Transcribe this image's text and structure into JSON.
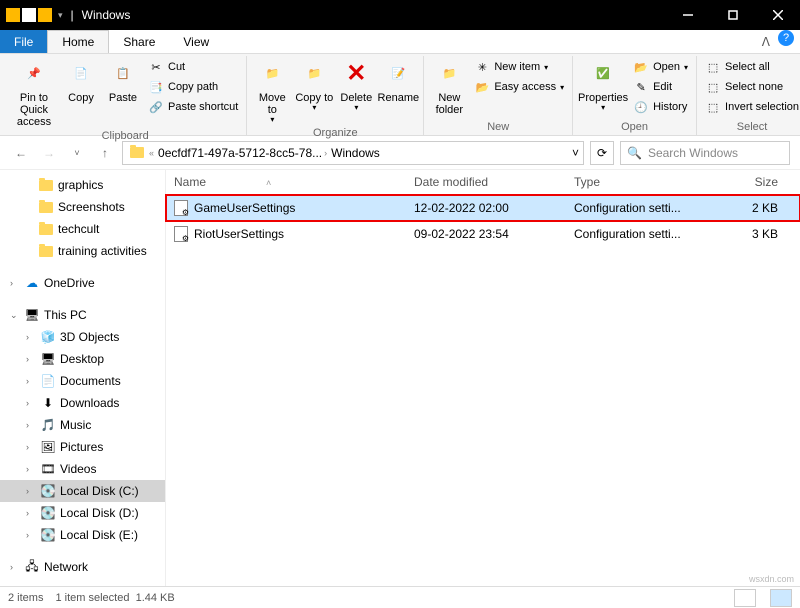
{
  "titlebar": {
    "title": "Windows"
  },
  "tabs": {
    "file": "File",
    "home": "Home",
    "share": "Share",
    "view": "View"
  },
  "ribbon": {
    "clipboard": {
      "label": "Clipboard",
      "pin": "Pin to Quick access",
      "copy": "Copy",
      "paste": "Paste",
      "cut": "Cut",
      "copypath": "Copy path",
      "shortcut": "Paste shortcut"
    },
    "organize": {
      "label": "Organize",
      "moveto": "Move to",
      "copyto": "Copy to",
      "delete": "Delete",
      "rename": "Rename"
    },
    "new": {
      "label": "New",
      "newfolder": "New folder",
      "newitem": "New item",
      "easyaccess": "Easy access"
    },
    "open": {
      "label": "Open",
      "properties": "Properties",
      "open": "Open",
      "edit": "Edit",
      "history": "History"
    },
    "select": {
      "label": "Select",
      "all": "Select all",
      "none": "Select none",
      "invert": "Invert selection"
    }
  },
  "breadcrumb": {
    "part1": "0ecfdf71-497a-5712-8cc5-78...",
    "part2": "Windows"
  },
  "search": {
    "placeholder": "Search Windows"
  },
  "tree": {
    "graphics": "graphics",
    "screenshots": "Screenshots",
    "techcult": "techcult",
    "training": "training activities",
    "onedrive": "OneDrive",
    "thispc": "This PC",
    "objects3d": "3D Objects",
    "desktop": "Desktop",
    "documents": "Documents",
    "downloads": "Downloads",
    "music": "Music",
    "pictures": "Pictures",
    "videos": "Videos",
    "diskc": "Local Disk (C:)",
    "diskd": "Local Disk (D:)",
    "diske": "Local Disk (E:)",
    "network": "Network"
  },
  "columns": {
    "name": "Name",
    "date": "Date modified",
    "type": "Type",
    "size": "Size"
  },
  "files": [
    {
      "name": "GameUserSettings",
      "date": "12-02-2022 02:00",
      "type": "Configuration setti...",
      "size": "2 KB"
    },
    {
      "name": "RiotUserSettings",
      "date": "09-02-2022 23:54",
      "type": "Configuration setti...",
      "size": "3 KB"
    }
  ],
  "status": {
    "items": "2 items",
    "selected": "1 item selected",
    "size": "1.44 KB"
  },
  "watermark": "wsxdn.com"
}
